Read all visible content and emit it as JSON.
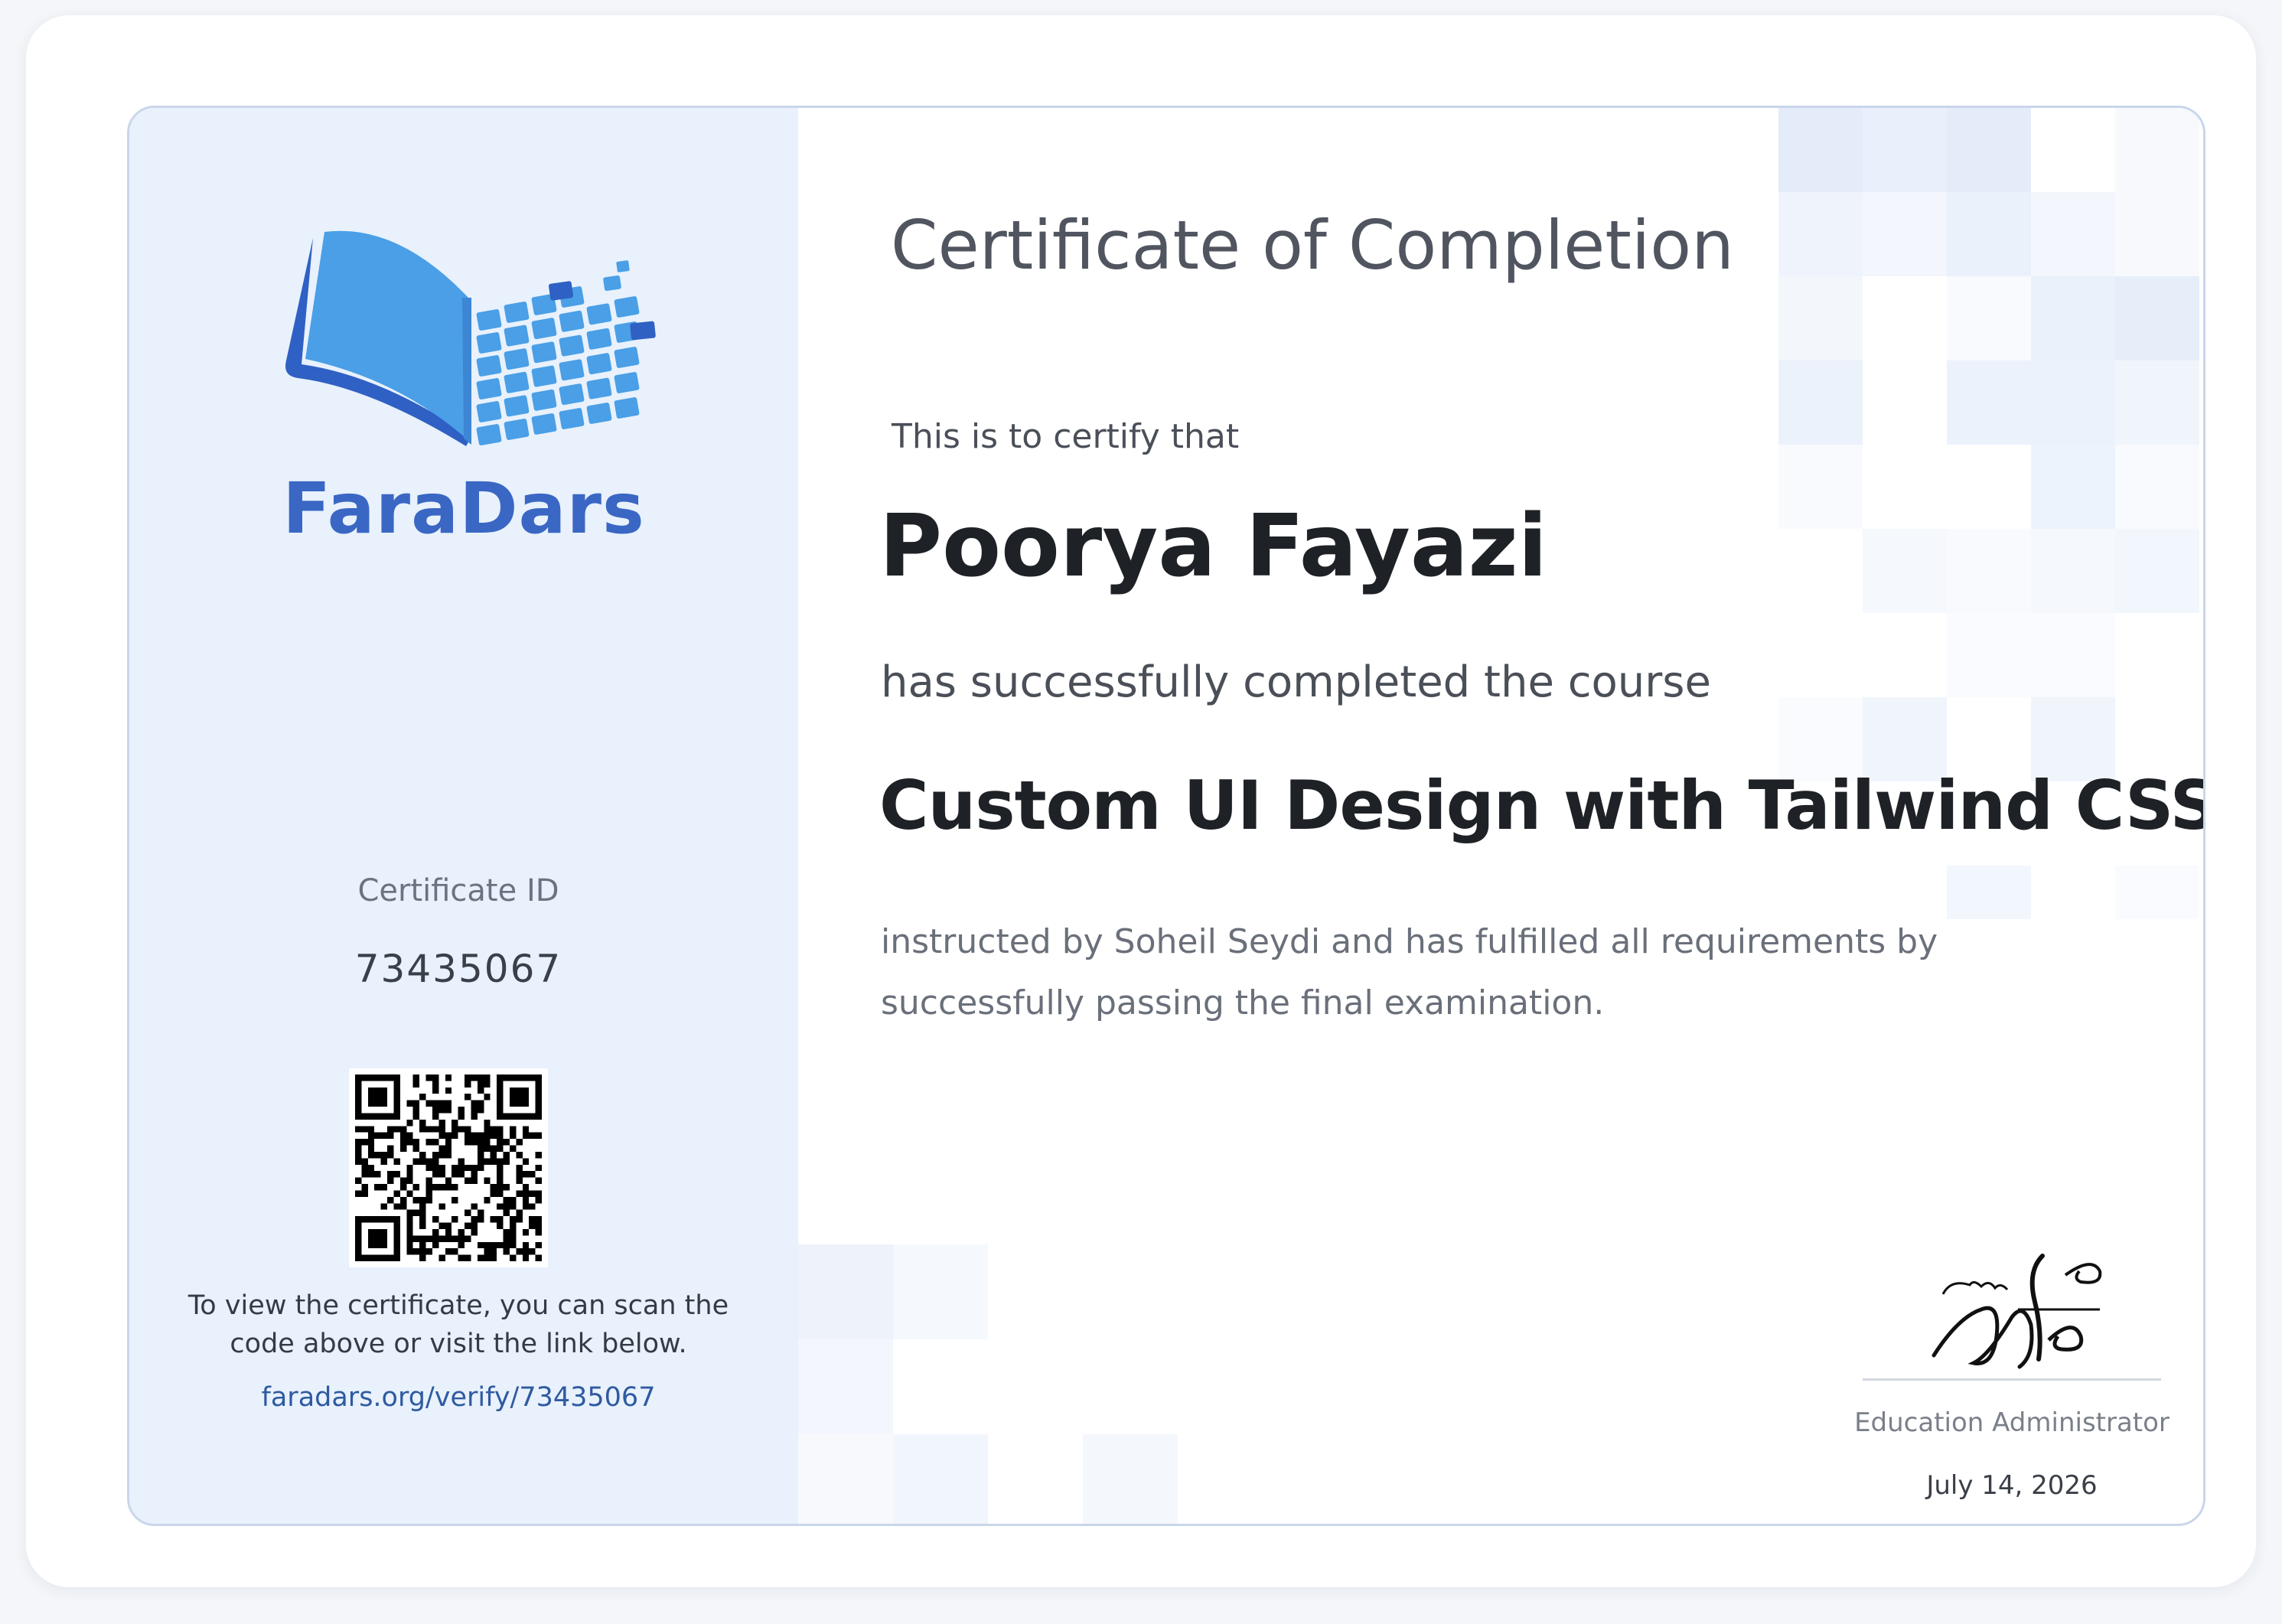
{
  "brand": {
    "name": "FaraDars",
    "colors": {
      "primary": "#3a67c4",
      "accent": "#4aa3e8",
      "panel": "#e8f1fc"
    }
  },
  "left": {
    "cert_id_label": "Certificate ID",
    "cert_id": "73435067",
    "scan_text": "To view the certificate, you can scan the code above or visit the link below.",
    "verify_url": "faradars.org/verify/73435067",
    "qr_icon": "qr-code-icon"
  },
  "main": {
    "title": "Certificate of Completion",
    "certify_line": "This is to certify that",
    "recipient": "Poorya Fayazi",
    "completed_line": "has successfully completed the course",
    "course": "Custom UI Design with Tailwind CSS",
    "description": "instructed by Soheil Seydi and has fulfilled all requirements by successfully passing the final examination."
  },
  "signature": {
    "role": "Education Administrator",
    "date": "July 14, 2026"
  }
}
